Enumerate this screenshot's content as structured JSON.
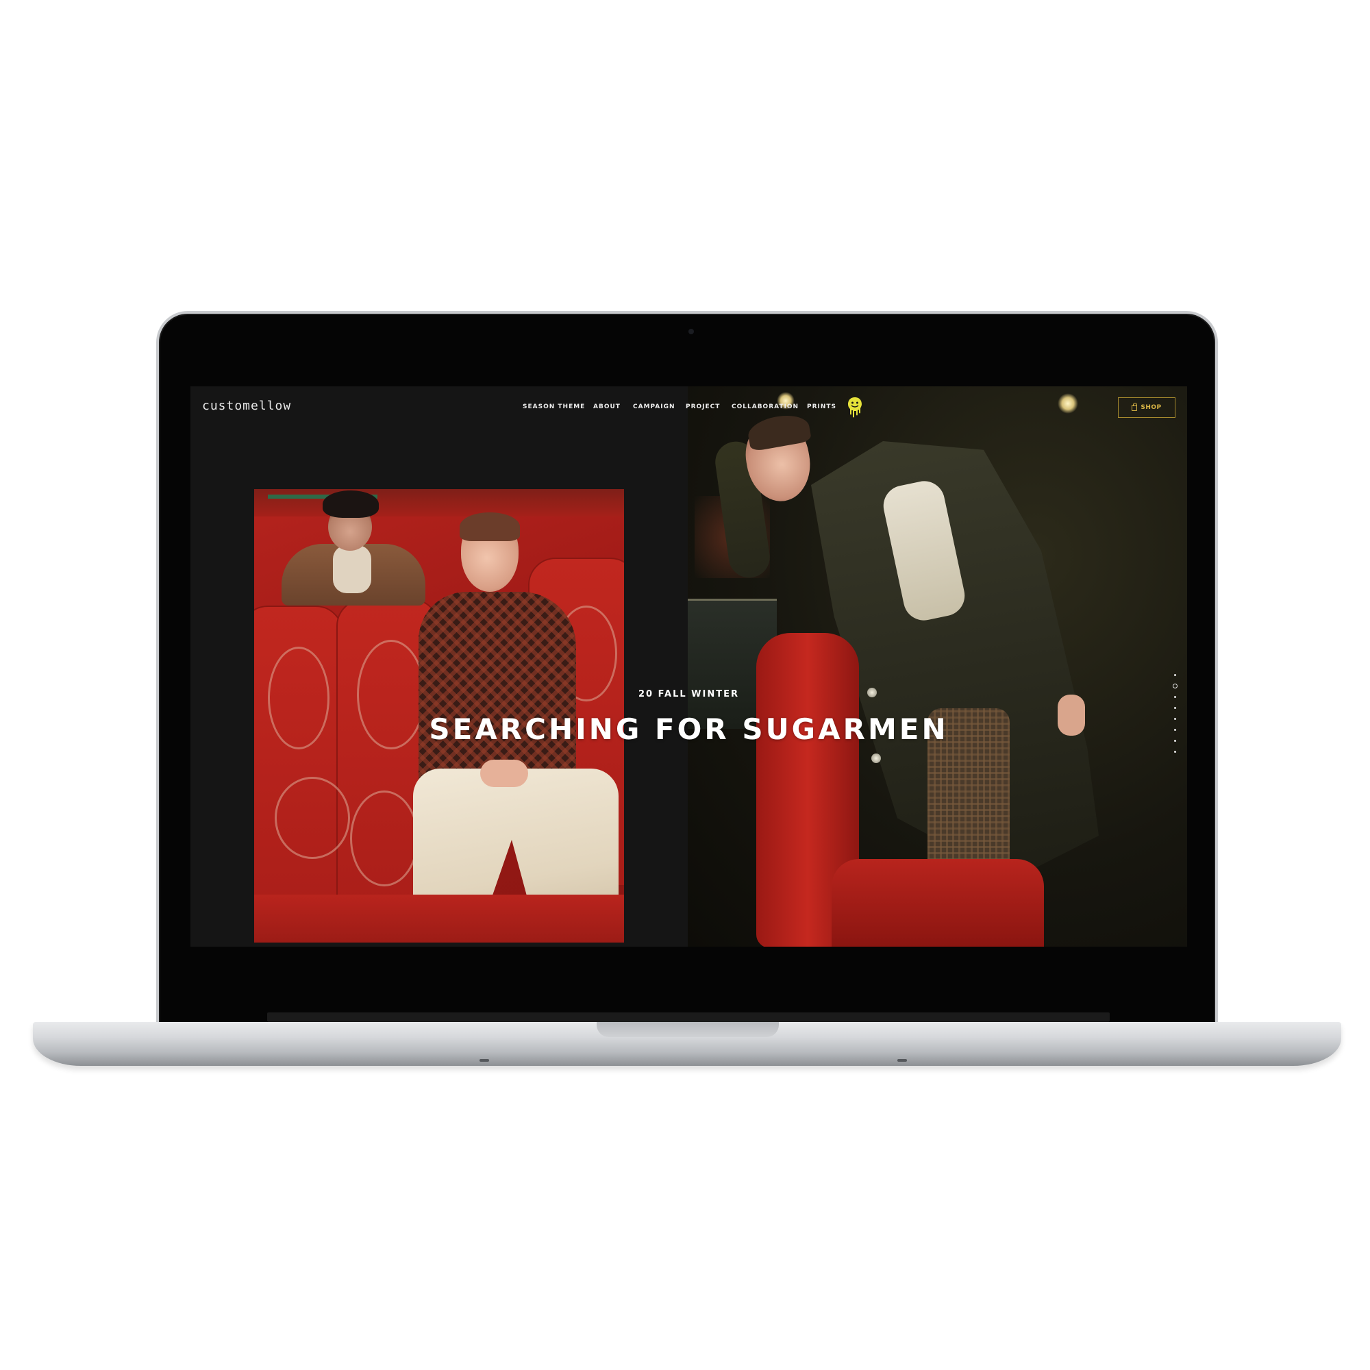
{
  "header": {
    "logo": "customellow",
    "nav": [
      {
        "label": "SEASON THEME"
      },
      {
        "label": "ABOUT"
      },
      {
        "label": "CAMPAIGN"
      },
      {
        "label": "PROJECT"
      },
      {
        "label": "COLLABORATION"
      },
      {
        "label": "PRINTS"
      }
    ],
    "mascot_icon": "dripping-smiley-icon",
    "shop_label": "SHOP",
    "shop_icon": "shopping-bag-icon"
  },
  "hero": {
    "subtitle": "20 FALL WINTER",
    "title": "SEARCHING FOR SUGARMEN"
  },
  "pager": {
    "count": 8,
    "active_index": 1
  },
  "colors": {
    "accent_gold": "#d8b445",
    "smiley_yellow": "#e6e23a",
    "background": "#151515"
  }
}
